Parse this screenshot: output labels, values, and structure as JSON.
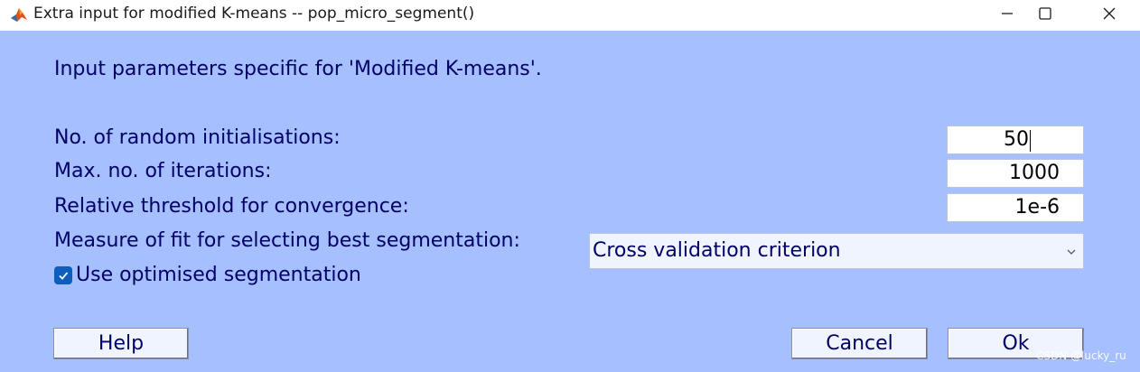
{
  "window": {
    "title": "Extra input for modified K-means -- pop_micro_segment()",
    "app_icon": "matlab-icon",
    "controls": [
      "minimize-icon",
      "maximize-icon",
      "close-icon"
    ]
  },
  "dialog": {
    "background": "#a6c0ff",
    "header": "Input parameters specific for 'Modified K-means'.",
    "fields": {
      "random_inits": {
        "label": "No. of random initialisations:",
        "value": "50"
      },
      "max_iter": {
        "label": "Max. no. of iterations:",
        "value": "1000"
      },
      "threshold": {
        "label": "Relative threshold for convergence:",
        "value": "1e-6"
      }
    },
    "measure": {
      "label": "Measure of fit for selecting best segmentation:",
      "selected": "Cross validation criterion"
    },
    "optimised": {
      "label": "Use optimised segmentation",
      "checked": true
    },
    "buttons": {
      "help": "Help",
      "cancel": "Cancel",
      "ok": "Ok"
    }
  },
  "watermark": "CSDN @lucky_ru"
}
